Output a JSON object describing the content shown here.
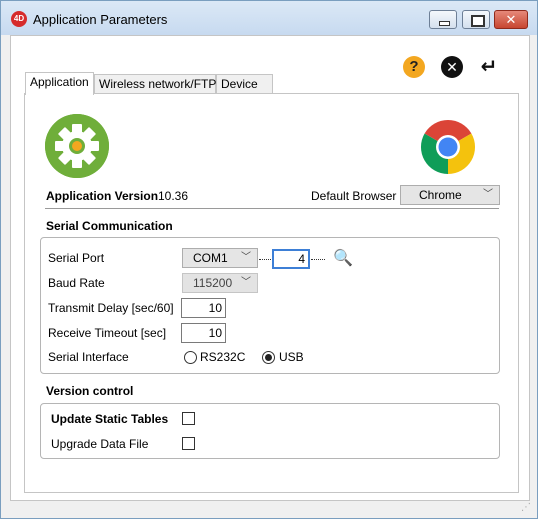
{
  "window": {
    "title": "Application Parameters",
    "app_icon_text": "4D",
    "close_glyph": "✕"
  },
  "toolbar": {
    "help_glyph": "?",
    "cancel_glyph": "✕",
    "enter_glyph": "↵"
  },
  "tabs": [
    {
      "label": "Application",
      "active": true
    },
    {
      "label": "Wireless network/FTP",
      "active": false
    },
    {
      "label": "Device",
      "active": false
    }
  ],
  "application": {
    "version_label": "Application Version",
    "version_value": "10.36",
    "default_browser_label": "Default Browser",
    "default_browser_value": "Chrome"
  },
  "serial": {
    "section_title": "Serial Communication",
    "port_label": "Serial Port",
    "port_value": "COM1",
    "port_number": "4",
    "baud_label": "Baud Rate",
    "baud_value": "115200",
    "transmit_label": "Transmit Delay  [sec/60]",
    "transmit_value": "10",
    "receive_label": "Receive Timeout [sec]",
    "receive_value": "10",
    "interface_label": "Serial Interface",
    "interface_options": [
      {
        "label": "RS232C",
        "selected": false
      },
      {
        "label": "USB",
        "selected": true
      }
    ]
  },
  "version_control": {
    "section_title": "Version control",
    "update_static_label": "Update Static Tables",
    "update_static_checked": false,
    "upgrade_data_label": "Upgrade Data File",
    "upgrade_data_checked": false
  },
  "icons": {
    "chevron": "﹀",
    "zoom": "🔍"
  },
  "colors": {
    "accent_focus": "#3d7fd6",
    "help_icon": "#f3a720",
    "gear_logo": "#6fae3a",
    "close_button": "#c74631"
  }
}
